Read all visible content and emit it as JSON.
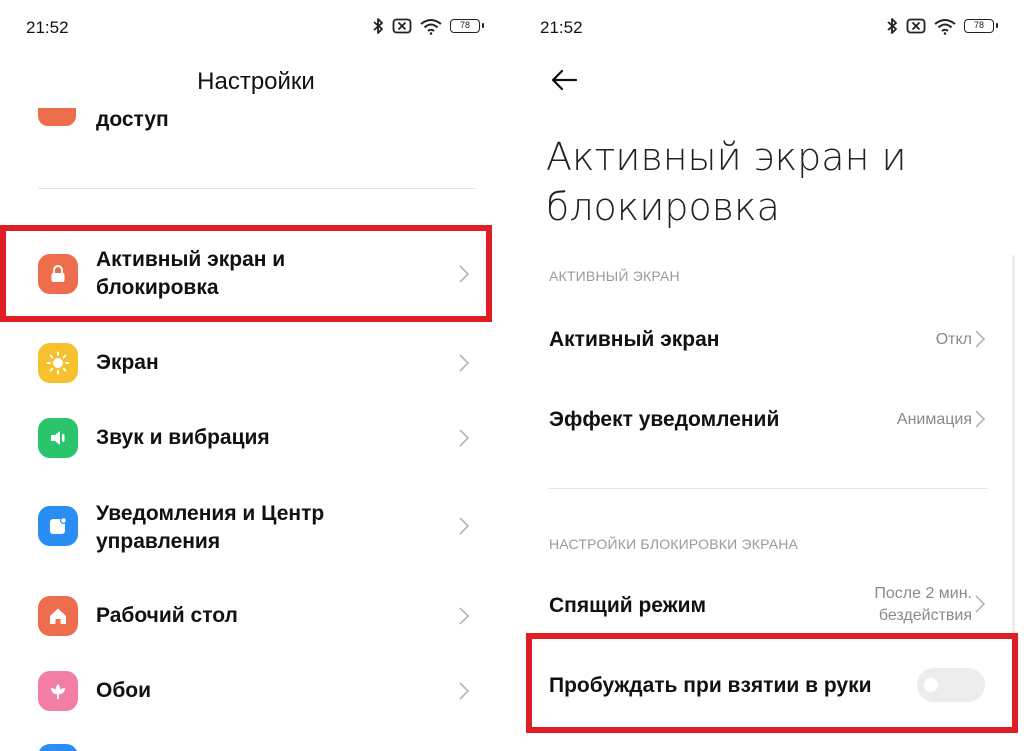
{
  "status_bar": {
    "time": "21:52",
    "battery": "78",
    "icons": [
      "bluetooth-icon",
      "signal-off-icon",
      "wifi-icon",
      "battery-icon"
    ]
  },
  "left": {
    "title": "Настройки",
    "partial_item": "доступ",
    "items": [
      {
        "label": "Активный экран и\nблокировка",
        "icon": "lock-icon",
        "color": "#ee6d4d"
      },
      {
        "label": "Экран",
        "icon": "sun-icon",
        "color": "#f7c12e"
      },
      {
        "label": "Звук и вибрация",
        "icon": "speaker-icon",
        "color": "#2bc46d"
      },
      {
        "label": "Уведомления и Центр\nуправления",
        "icon": "notification-icon",
        "color": "#2a8df4"
      },
      {
        "label": "Рабочий стол",
        "icon": "home-icon",
        "color": "#ee6d4d"
      },
      {
        "label": "Обои",
        "icon": "flower-icon",
        "color": "#f27ea6"
      }
    ]
  },
  "right": {
    "title": "Активный экран и\nблокировка",
    "section_active": "АКТИВНЫЙ ЭКРАН",
    "active_screen": {
      "label": "Активный экран",
      "value": "Откл"
    },
    "notification_effect": {
      "label": "Эффект уведомлений",
      "value": "Анимация"
    },
    "section_lock": "НАСТРОЙКИ БЛОКИРОВКИ ЭКРАНА",
    "sleep": {
      "label": "Спящий режим",
      "value": "После 2 мин.\nбездействия"
    },
    "raise_to_wake": {
      "label": "Пробуждать при взятии в руки",
      "enabled": false
    }
  },
  "colors": {
    "highlight": "#e01e25",
    "accent_orange": "#ee6d4d"
  }
}
